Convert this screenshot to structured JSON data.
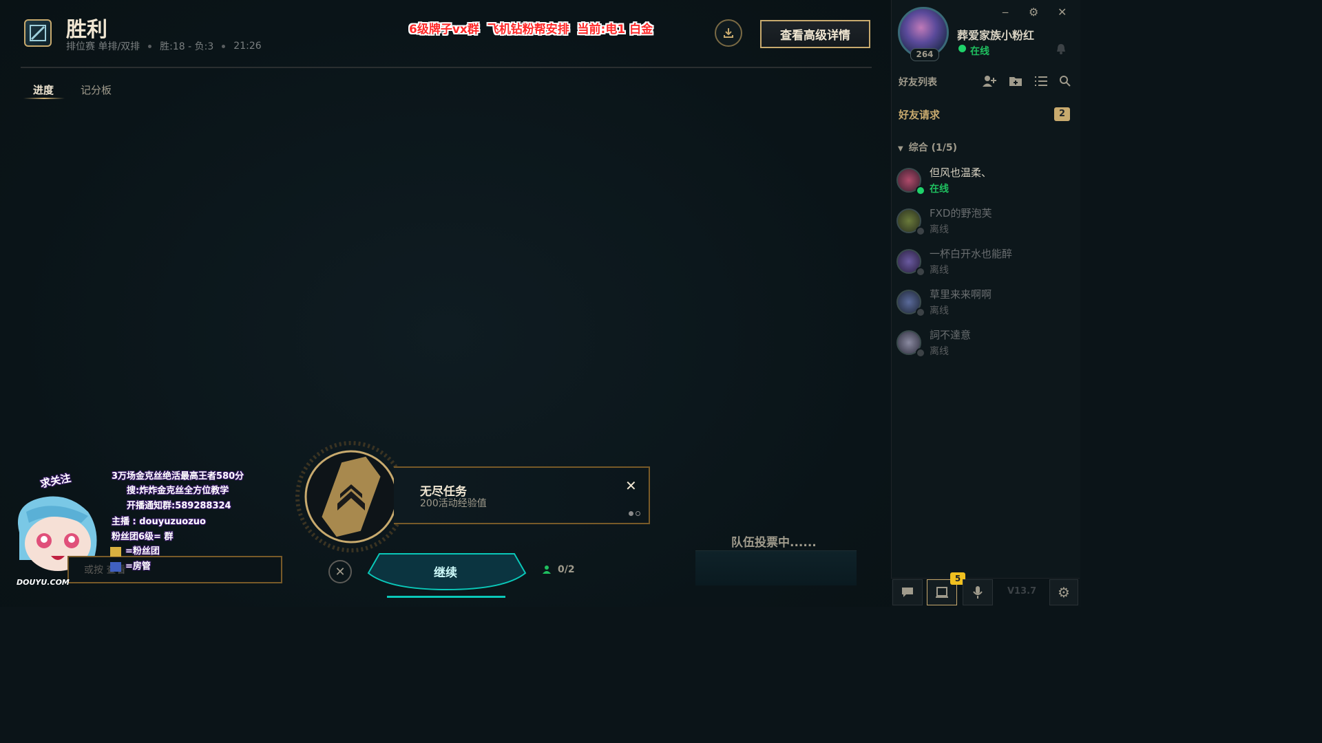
{
  "header": {
    "title": "胜利",
    "queue": "排位赛 单排/双排",
    "record": "胜:18 - 负:3",
    "duration": "21:26",
    "promo": "6级牌子vx群  飞机钻粉帮安排  当前:电1 白金",
    "advanced_button": "查看高级详情"
  },
  "tabs": [
    {
      "label": "进度",
      "active": true
    },
    {
      "label": "记分板",
      "active": false
    }
  ],
  "mission": {
    "title": "无尽任务",
    "subtitle": "200活动经验值",
    "pager_count": 2,
    "pager_active": 1
  },
  "actions": {
    "continue_label": "继续",
    "vote_count": "0/2",
    "team_vote_status": "队伍投票中......"
  },
  "overlay": {
    "follow": "求关注",
    "lines": [
      "3万场金克丝绝活最高王者580分",
      "搜:炸炸金克丝全方位教学",
      "开播通知群:589288324",
      "主播  : douyuzuozuo",
      "粉丝团6级=  群",
      "=粉丝团",
      "=房管"
    ],
    "chat_placeholder": "或按  查看",
    "watermark": "DOUYU.COM"
  },
  "sidebar": {
    "profile_name": "葬爱家族小粉红",
    "profile_status": "在线",
    "profile_level": "264",
    "friend_list_title": "好友列表",
    "friend_requests_label": "好友请求",
    "friend_requests_count": "2",
    "group_header": "综合 (1/5)",
    "friends": [
      {
        "name": "但风也温柔、",
        "status": "在线",
        "online": true
      },
      {
        "name": "FXD的野泡芙",
        "status": "离线",
        "online": false
      },
      {
        "name": "一杯白开水也能醉",
        "status": "离线",
        "online": false
      },
      {
        "name": "草里来来啊啊",
        "status": "离线",
        "online": false
      },
      {
        "name": "詞不達意",
        "status": "离线",
        "online": false
      }
    ],
    "notification_count": "5",
    "version": "V13.7"
  },
  "colors": {
    "gold": "#c8aa6e",
    "online_green": "#1fbf5f",
    "promo_red": "#ff2a2a",
    "teal": "#0ac8b9"
  }
}
